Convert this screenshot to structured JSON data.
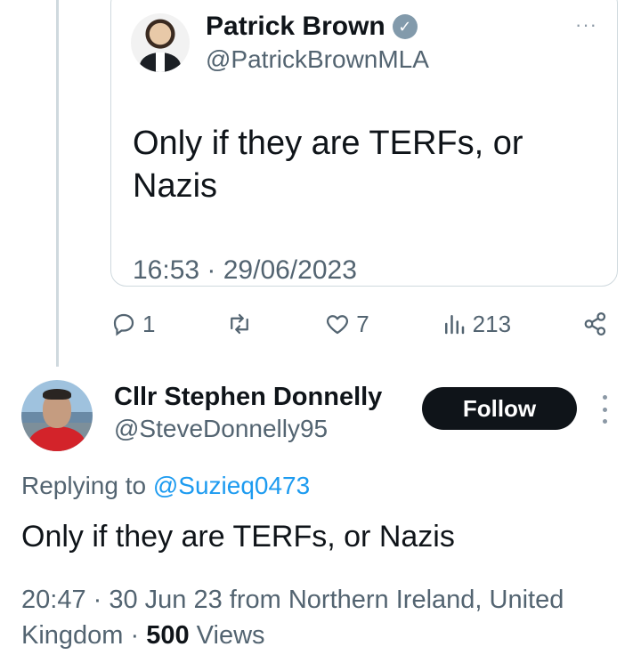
{
  "quoted_tweet": {
    "name": "Patrick Brown",
    "handle": "@PatrickBrownMLA",
    "more": "···",
    "text": "Only if they are TERFs, or Nazis",
    "timestamp": "16:53 · 29/06/2023"
  },
  "actions": {
    "replies": "1",
    "likes": "7",
    "views": "213",
    "icons": [
      "reply-icon",
      "retweet-icon",
      "like-icon",
      "views-icon",
      "share-icon"
    ]
  },
  "tweet": {
    "author_name": "Cllr Stephen Donnelly",
    "author_handle": "@SteveDonnelly95",
    "follow_label": "Follow",
    "replying_prefix": "Replying to ",
    "replying_to": "@Suzieq0473",
    "text": "Only if they are TERFs, or Nazis",
    "meta_line1": "20:47 · 30 Jun 23 from Northern Ireland, United",
    "meta_line2_prefix": "Kingdom · ",
    "views_count": "500",
    "views_label": " Views"
  },
  "colors": {
    "text": "#0f1419",
    "secondary": "#536471",
    "link": "#1d9bf0",
    "border": "#cfd9de",
    "verified": "#829aab"
  }
}
